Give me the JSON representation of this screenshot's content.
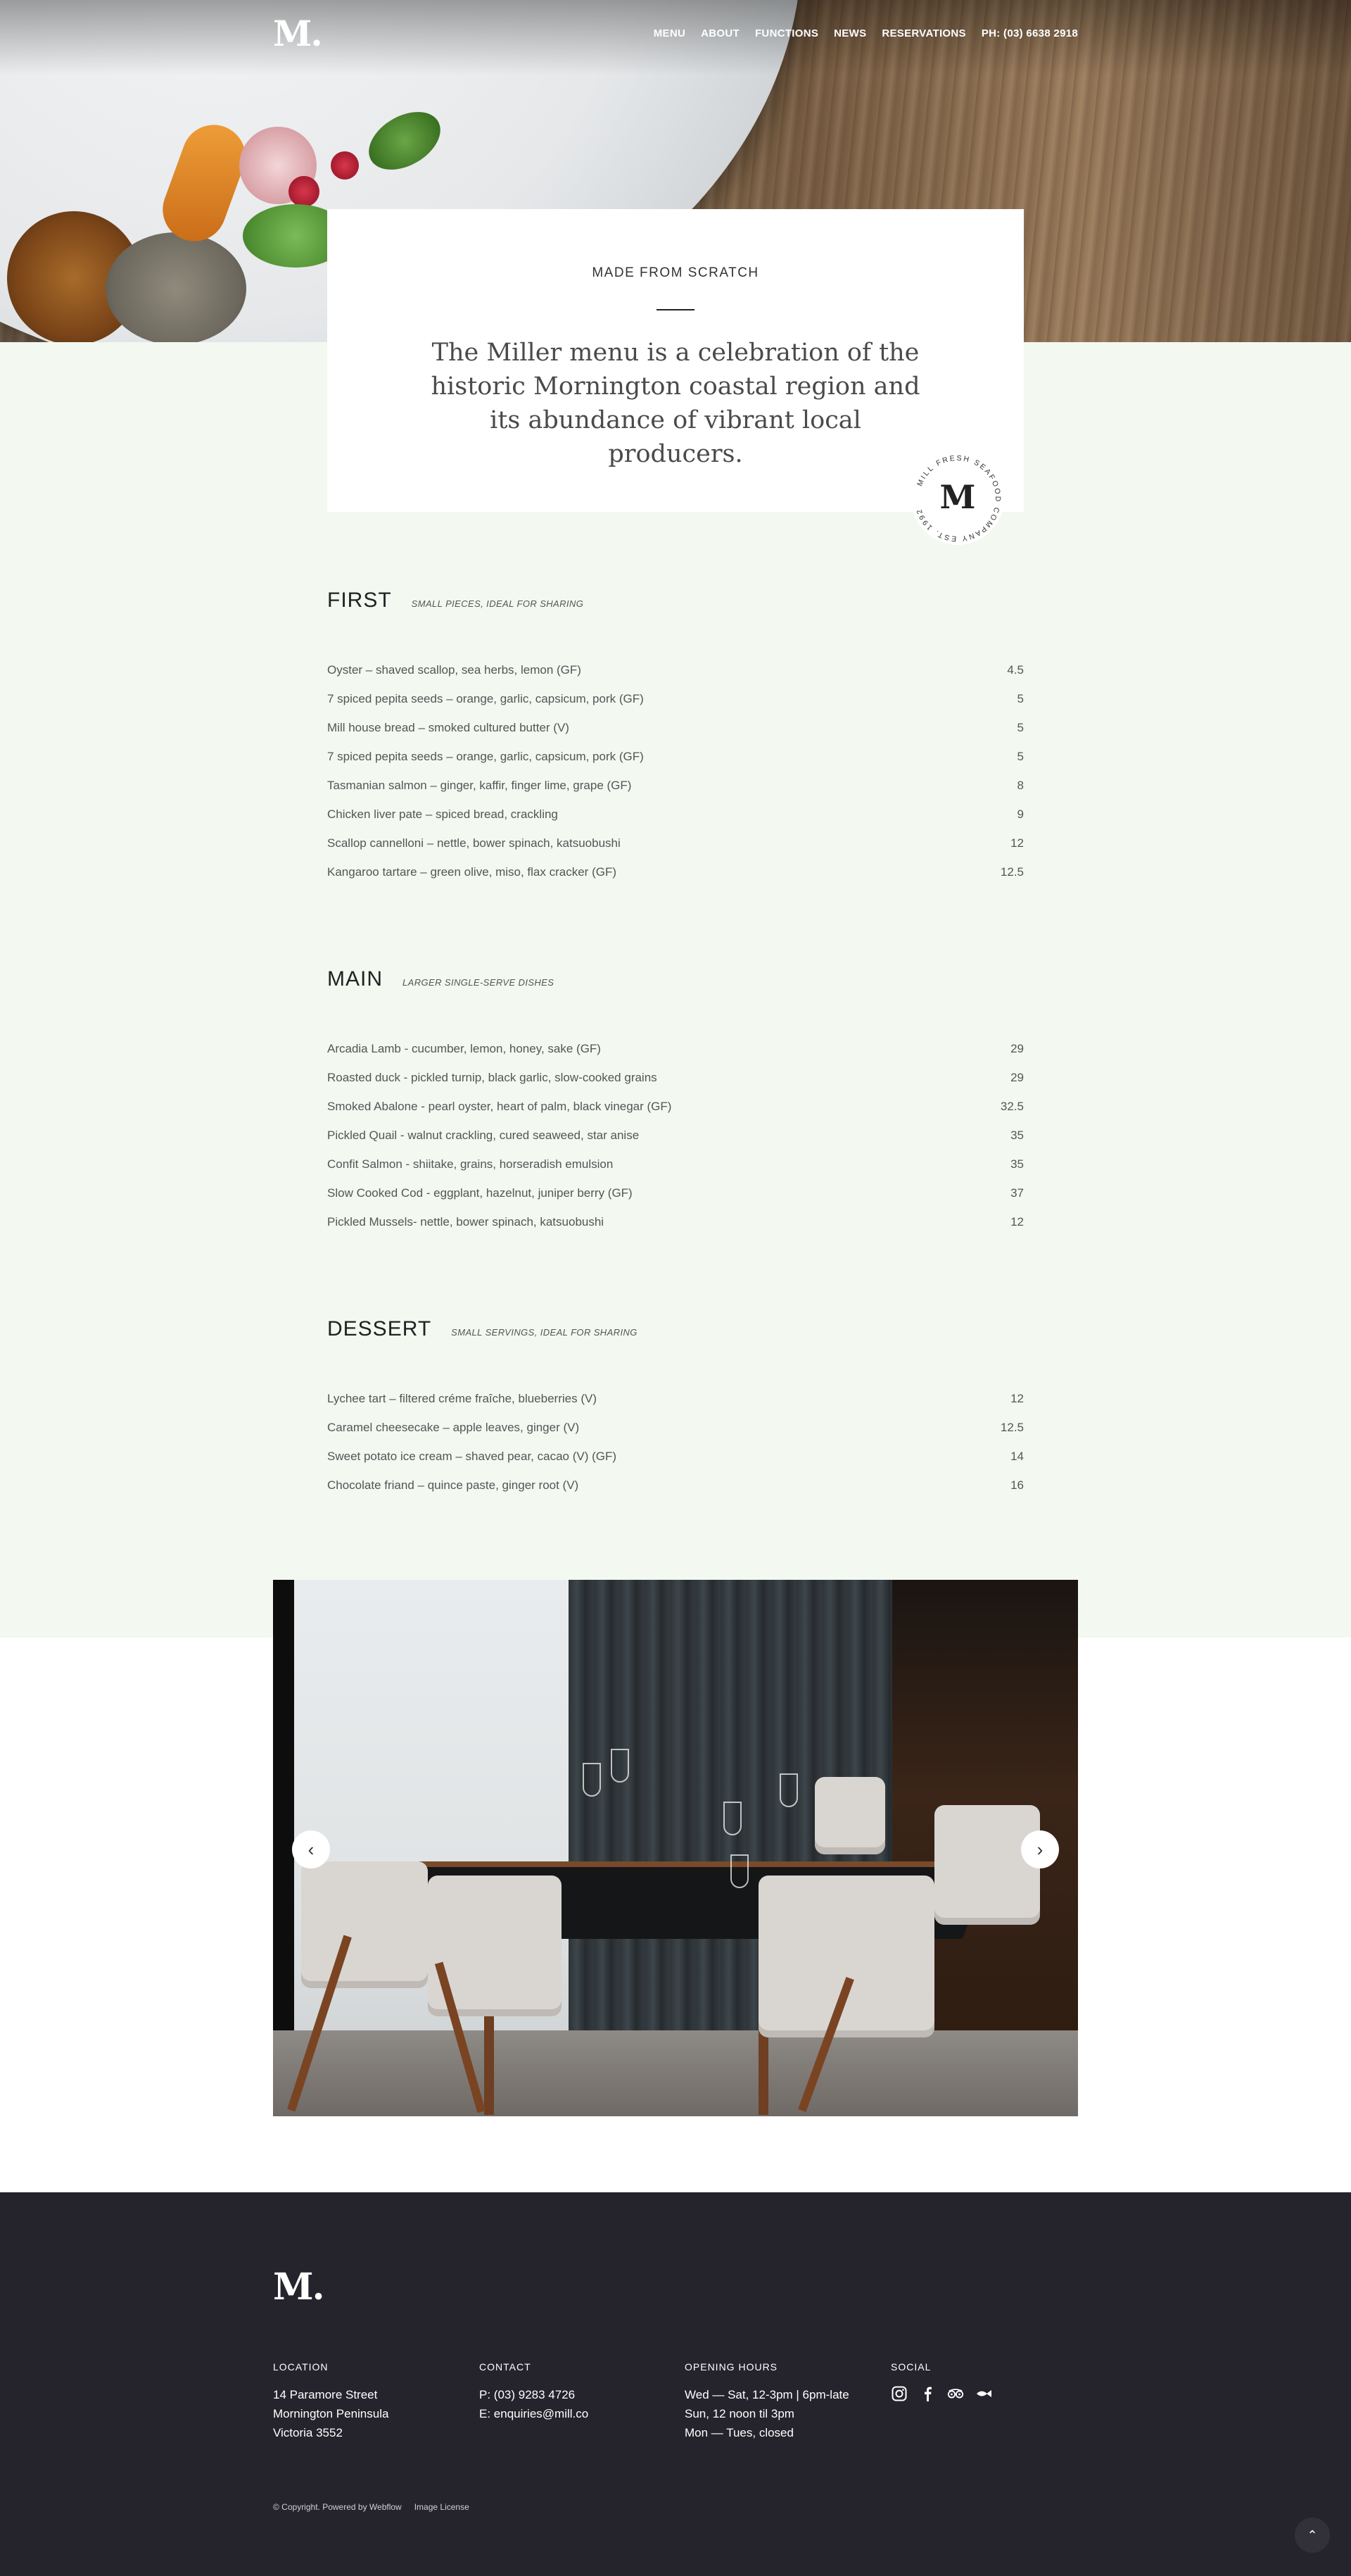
{
  "nav": {
    "logo": "M.",
    "links": [
      "MENU",
      "ABOUT",
      "FUNCTIONS",
      "NEWS",
      "RESERVATIONS",
      "PH: (03) 6638 2918"
    ]
  },
  "intro": {
    "kicker": "MADE FROM SCRATCH",
    "text": "The Miller menu is a celebration of the historic Mornington coastal region and its abundance of vibrant local producers."
  },
  "badge": {
    "ring_text": "MILL FRESH SEAFOOD COMPANY EST. 1992",
    "letter": "M"
  },
  "menus": [
    {
      "title": "FIRST",
      "subtitle": "SMALL PIECES, IDEAL FOR SHARING",
      "items": [
        {
          "name": "Oyster – shaved scallop, sea herbs, lemon (GF)",
          "price": "4.5"
        },
        {
          "name": "7 spiced pepita seeds – orange, garlic, capsicum, pork (GF)",
          "price": "5"
        },
        {
          "name": "Mill house bread – smoked cultured butter (V)",
          "price": "5"
        },
        {
          "name": "7 spiced pepita seeds – orange, garlic, capsicum, pork (GF)",
          "price": "5"
        },
        {
          "name": "Tasmanian salmon – ginger, kaffir, finger lime, grape (GF)",
          "price": "8"
        },
        {
          "name": "Chicken liver pate – spiced bread, crackling",
          "price": "9"
        },
        {
          "name": "Scallop cannelloni – nettle, bower spinach, katsuobushi",
          "price": "12"
        },
        {
          "name": "Kangaroo tartare – green olive, miso, flax cracker (GF)",
          "price": "12.5"
        }
      ]
    },
    {
      "title": "MAIN",
      "subtitle": "LARGER SINGLE-SERVE DISHES",
      "items": [
        {
          "name": "Arcadia Lamb - cucumber, lemon, honey, sake (GF)",
          "price": "29"
        },
        {
          "name": "Roasted duck - pickled turnip, black garlic, slow-cooked grains",
          "price": "29"
        },
        {
          "name": "Smoked Abalone - pearl oyster, heart of palm, black vinegar (GF)",
          "price": "32.5"
        },
        {
          "name": "Pickled Quail - walnut crackling, cured seaweed, star anise",
          "price": "35"
        },
        {
          "name": "Confit Salmon - shiitake, grains, horseradish emulsion",
          "price": "35"
        },
        {
          "name": "Slow Cooked Cod - eggplant, hazelnut, juniper berry (GF)",
          "price": "37"
        },
        {
          "name": "Pickled Mussels- nettle, bower spinach, katsuobushi",
          "price": "12"
        }
      ]
    },
    {
      "title": "DESSERT",
      "subtitle": "SMALL SERVINGS, IDEAL FOR SHARING",
      "items": [
        {
          "name": "Lychee tart – filtered créme fraîche, blueberries (V)",
          "price": "12"
        },
        {
          "name": "Caramel cheesecake – apple leaves, ginger (V)",
          "price": "12.5"
        },
        {
          "name": "Sweet potato ice cream – shaved pear, cacao (V) (GF)",
          "price": "14"
        },
        {
          "name": "Chocolate friand – quince paste, ginger root (V)",
          "price": "16"
        }
      ]
    }
  ],
  "gallery": {
    "prev_icon": "chevron-left-icon",
    "next_icon": "chevron-right-icon"
  },
  "footer": {
    "logo": "M.",
    "location": {
      "title": "LOCATION",
      "lines": [
        "14 Paramore Street",
        "Mornington Peninsula",
        "Victoria 3552"
      ]
    },
    "contact": {
      "title": "CONTACT",
      "phone": "P: (03) 9283 4726",
      "email_prefix": "E: ",
      "email": "enquiries@mill.co"
    },
    "hours": {
      "title": "OPENING HOURS",
      "lines": [
        "Wed — Sat, 12-3pm | 6pm-late",
        "Sun, 12 noon til 3pm",
        "Mon — Tues, closed"
      ]
    },
    "social": {
      "title": "SOCIAL",
      "icons": [
        "instagram-icon",
        "facebook-icon",
        "tripadvisor-icon",
        "fish-icon"
      ]
    },
    "copyright": "© Copyright. Powered by Webflow",
    "license": "Image License"
  }
}
